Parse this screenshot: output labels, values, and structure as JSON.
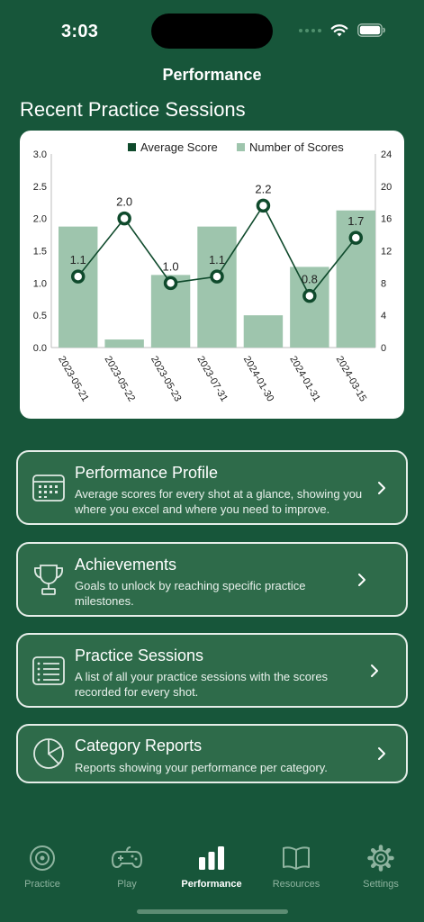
{
  "status_bar": {
    "time": "3:03"
  },
  "nav": {
    "title": "Performance"
  },
  "section": {
    "title": "Recent Practice Sessions"
  },
  "chart_data": {
    "type": "bar",
    "categories": [
      "2023-05-21",
      "2023-05-22",
      "2023-05-23",
      "2023-07-31",
      "2024-01-30",
      "2024-01-31",
      "2024-03-15"
    ],
    "series": [
      {
        "name": "Number of Scores",
        "type": "bar",
        "axis": "right",
        "values": [
          15,
          1,
          9,
          15,
          4,
          10,
          17
        ],
        "color": "#9ec5ad"
      },
      {
        "name": "Average Score",
        "type": "line",
        "axis": "left",
        "values": [
          1.1,
          2.0,
          1.0,
          1.1,
          2.2,
          0.8,
          1.7
        ],
        "labels": [
          "1.1",
          "2.0",
          "1.0",
          "1.1",
          "2.2",
          "0.8",
          "1.7"
        ],
        "color": "#0f4a2c"
      }
    ],
    "y_left": {
      "range": [
        0,
        3.0
      ],
      "ticks": [
        "0.0",
        "0.5",
        "1.0",
        "1.5",
        "2.0",
        "2.5",
        "3.0"
      ]
    },
    "y_right": {
      "range": [
        0,
        24
      ],
      "ticks": [
        "0",
        "4",
        "8",
        "12",
        "16",
        "20",
        "24"
      ]
    },
    "legend_placement": "top-center",
    "grid": false
  },
  "menu": [
    {
      "title": "Performance Profile",
      "description": "Average scores for every shot at a glance, showing you where you excel and where you need to improve.",
      "icon": "calendar-icon"
    },
    {
      "title": "Achievements",
      "description": "Goals to unlock by reaching specific practice milestones.",
      "icon": "trophy-icon"
    },
    {
      "title": "Practice Sessions",
      "description": "A list of all your practice sessions with the scores recorded for every shot.",
      "icon": "list-icon"
    },
    {
      "title": "Category Reports",
      "description": "Reports showing your performance per category.",
      "icon": "pie-chart-icon"
    }
  ],
  "tabs": [
    {
      "label": "Practice",
      "icon": "target-icon",
      "active": false
    },
    {
      "label": "Play",
      "icon": "gamepad-icon",
      "active": false
    },
    {
      "label": "Performance",
      "icon": "bar-chart-icon",
      "active": true
    },
    {
      "label": "Resources",
      "icon": "book-icon",
      "active": false
    },
    {
      "label": "Settings",
      "icon": "gear-icon",
      "active": false
    }
  ],
  "colors": {
    "background": "#17563a",
    "card": "#2e6b4a",
    "bar": "#9ec5ad",
    "line": "#0f4a2c",
    "tab_inactive": "#8fb4a0"
  }
}
